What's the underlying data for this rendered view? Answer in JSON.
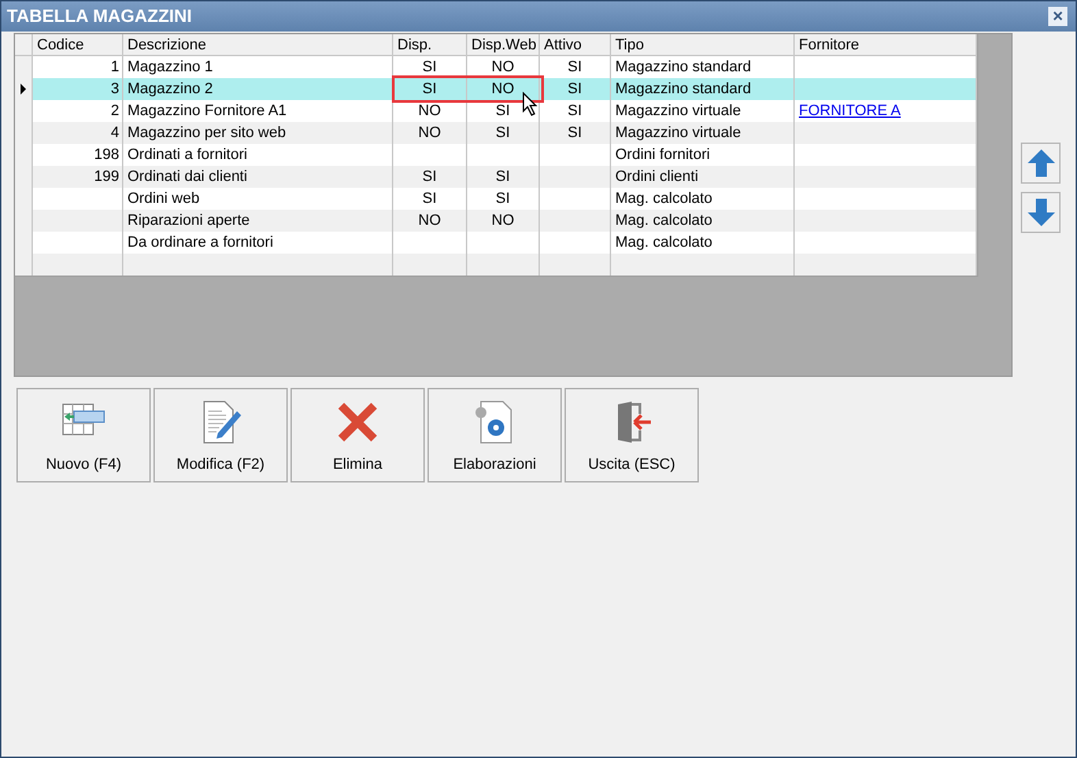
{
  "window": {
    "title": "TABELLA MAGAZZINI",
    "close": "×"
  },
  "table": {
    "columns": [
      "Codice",
      "Descrizione",
      "Disp.",
      "Disp.Web",
      "Attivo",
      "Tipo",
      "Fornitore"
    ],
    "rows": [
      {
        "codice": "1",
        "descrizione": "Magazzino 1",
        "disp": "SI",
        "disp_web": "NO",
        "attivo": "SI",
        "tipo": "Magazzino standard",
        "selected": false
      },
      {
        "codice": "3",
        "descrizione": "Magazzino 2",
        "disp": "SI",
        "disp_web": "NO",
        "attivo": "SI",
        "tipo": "Magazzino standard",
        "selected": true
      },
      {
        "codice": "2",
        "descrizione": "Magazzino Fornitore A1",
        "disp": "NO",
        "disp_web": "SI",
        "attivo": "SI",
        "tipo": "Magazzino virtuale",
        "fornitore": "FORNITORE A",
        "selected": false
      },
      {
        "codice": "4",
        "descrizione": "Magazzino per sito web",
        "disp": "NO",
        "disp_web": "SI",
        "attivo": "SI",
        "tipo": "Magazzino virtuale",
        "selected": false
      },
      {
        "codice": "198",
        "descrizione": "Ordinati a fornitori",
        "tipo": "Ordini fornitori",
        "selected": false
      },
      {
        "codice": "199",
        "descrizione": "Ordinati dai clienti",
        "disp": "SI",
        "disp_web": "SI",
        "tipo": "Ordini clienti",
        "selected": false
      },
      {
        "descrizione": "Ordini web",
        "disp": "SI",
        "disp_web": "SI",
        "tipo": "Mag. calcolato",
        "selected": false
      },
      {
        "descrizione": "Riparazioni aperte",
        "disp": "NO",
        "disp_web": "NO",
        "tipo": "Mag. calcolato",
        "selected": false
      },
      {
        "descrizione": "Da ordinare a fornitori",
        "tipo": "Mag. calcolato",
        "selected": false
      }
    ]
  },
  "buttons": [
    {
      "label": "Nuovo (F4)",
      "kind": "new"
    },
    {
      "label": "Modifica (F2)",
      "kind": "edit"
    },
    {
      "label": "Elimina",
      "kind": "delete"
    },
    {
      "label": "Elaborazioni",
      "kind": "process"
    },
    {
      "label": "Uscita (ESC)",
      "kind": "exit"
    }
  ]
}
